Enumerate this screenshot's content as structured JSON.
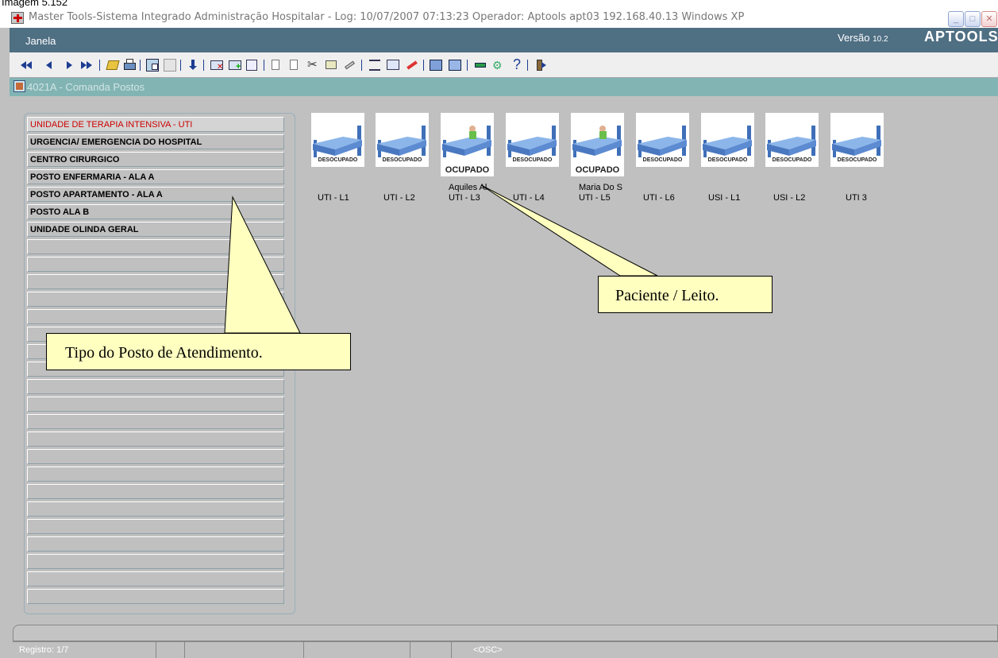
{
  "caption": "Imagem 5.152",
  "window": {
    "title": "Master Tools-Sistema Integrado Administração Hospitalar - Log: 10/07/2007 07:13:23 Operador: Aptools apt03 192.168.40.13 Windows XP",
    "minimize": "_",
    "maximize": "□",
    "close": "✕"
  },
  "menu": {
    "janela": "Janela",
    "version_prefix": "Versão",
    "version_number": "10.2",
    "brand": "APTOOLS"
  },
  "form": {
    "title": "4021A - Comanda Postos"
  },
  "postos": [
    "UNIDADE DE TERAPIA INTENSIVA - UTI",
    "URGENCIA/ EMERGENCIA DO HOSPITAL",
    "CENTRO CIRURGICO",
    "POSTO ENFERMARIA - ALA A",
    "POSTO APARTAMENTO - ALA A",
    "POSTO ALA B",
    "UNIDADE OLINDA GERAL"
  ],
  "beds": [
    {
      "label": "UTI - L1",
      "status": "DESOCUPADO",
      "patient": ""
    },
    {
      "label": "UTI - L2",
      "status": "DESOCUPADO",
      "patient": ""
    },
    {
      "label": "UTI - L3",
      "status": "OCUPADO",
      "patient": "Aquiles Al"
    },
    {
      "label": "UTI - L4",
      "status": "DESOCUPADO",
      "patient": ""
    },
    {
      "label": "UTI - L5",
      "status": "OCUPADO",
      "patient": "Maria Do S"
    },
    {
      "label": "UTI - L6",
      "status": "DESOCUPADO",
      "patient": ""
    },
    {
      "label": "USI - L1",
      "status": "DESOCUPADO",
      "patient": ""
    },
    {
      "label": "USI - L2",
      "status": "DESOCUPADO",
      "patient": ""
    },
    {
      "label": "UTI 3",
      "status": "DESOCUPADO",
      "patient": ""
    }
  ],
  "callouts": {
    "leito": "Paciente / Leito.",
    "posto": "Tipo do  Posto de Atendimento."
  },
  "status": {
    "registro": "Registro: 1/7",
    "mode": "<OSC>"
  },
  "colors": {
    "menubar": "#4f6f83",
    "formtitle": "#82b4b4",
    "callout": "#ffffc0",
    "bed_blue": "#4a78c0",
    "selected_text": "#cc0000"
  },
  "toolbar_icons": [
    "first-record-icon",
    "previous-record-icon",
    "next-record-icon",
    "last-record-icon",
    "open-icon",
    "print-icon",
    "query-icon",
    "execute-query-icon",
    "download-icon",
    "delete-record-icon",
    "insert-record-icon",
    "duplicate-record-icon",
    "copy-icon",
    "paste-icon",
    "cut-icon",
    "edit-icon",
    "clear-icon",
    "list-icon",
    "report-icon",
    "tools-icon",
    "calculator-icon",
    "table-icon",
    "window-icon",
    "help-wizard-icon",
    "help-icon",
    "exit-icon"
  ]
}
